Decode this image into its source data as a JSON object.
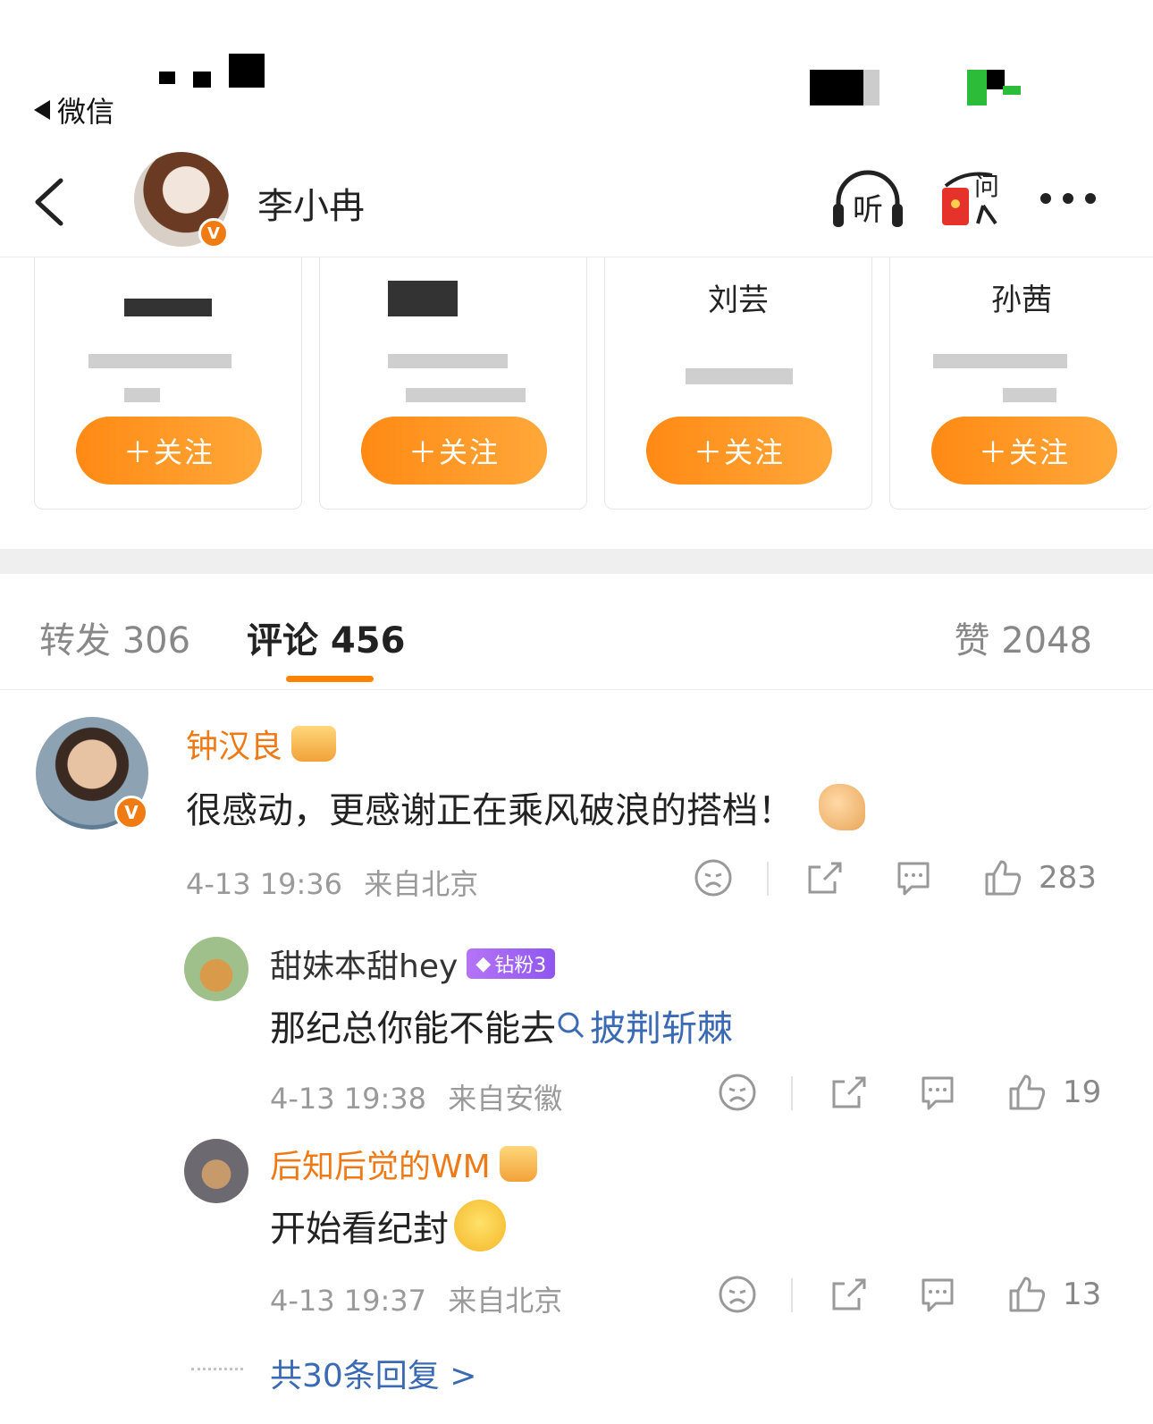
{
  "status_bar": {
    "back_label": "微信"
  },
  "header": {
    "name": "李小冉",
    "listen_label": "听",
    "ask_label": "问"
  },
  "cards": [
    {
      "name": "",
      "follow_label": "＋关注"
    },
    {
      "name": "",
      "follow_label": "＋关注"
    },
    {
      "name": "刘芸",
      "follow_label": "＋关注"
    },
    {
      "name": "孙茜",
      "follow_label": "＋关注"
    }
  ],
  "tabs": {
    "repost": "转发 306",
    "comments": "评论 456",
    "likes": "赞 2048"
  },
  "comments": [
    {
      "user": "钟汉良",
      "text": "很感动，更感谢正在乘风破浪的搭档！",
      "time": "4-13 19:36",
      "location": "来自北京",
      "likes": "283"
    },
    {
      "user": "甜妹本甜hey",
      "badge": "钻粉3",
      "text": "那纪总你能不能去",
      "topic": "披荆斩棘",
      "time": "4-13 19:38",
      "location": "来自安徽",
      "likes": "19"
    },
    {
      "user": "后知后觉的WM",
      "text": "开始看纪封",
      "time": "4-13 19:37",
      "location": "来自北京",
      "likes": "13"
    }
  ],
  "more_replies": "共30条回复 >",
  "colors": {
    "accent": "#ff8200",
    "link": "#3a6ab3",
    "username": "#ee7a17"
  }
}
